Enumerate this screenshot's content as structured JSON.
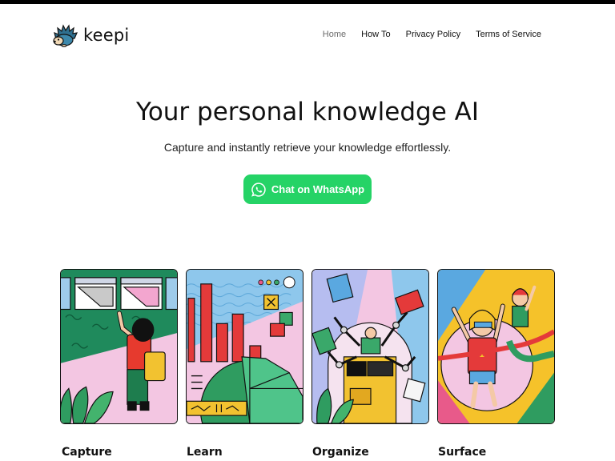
{
  "header": {
    "logo_icon": "hedgehog-icon",
    "brand": "keepi",
    "nav": [
      {
        "label": "Home",
        "active": true
      },
      {
        "label": "How To",
        "active": false
      },
      {
        "label": "Privacy Policy",
        "active": false
      },
      {
        "label": "Terms of Service",
        "active": false
      }
    ]
  },
  "hero": {
    "title": "Your personal knowledge AI",
    "subtitle": "Capture and instantly retrieve your knowledge effortlessly.",
    "cta_label": "Chat on WhatsApp",
    "cta_icon": "whatsapp-icon",
    "cta_color": "#25d366"
  },
  "features": [
    {
      "title": "Capture",
      "illustration": "capture-illustration"
    },
    {
      "title": "Learn",
      "illustration": "learn-illustration"
    },
    {
      "title": "Organize",
      "illustration": "organize-illustration"
    },
    {
      "title": "Surface",
      "illustration": "surface-illustration"
    }
  ]
}
